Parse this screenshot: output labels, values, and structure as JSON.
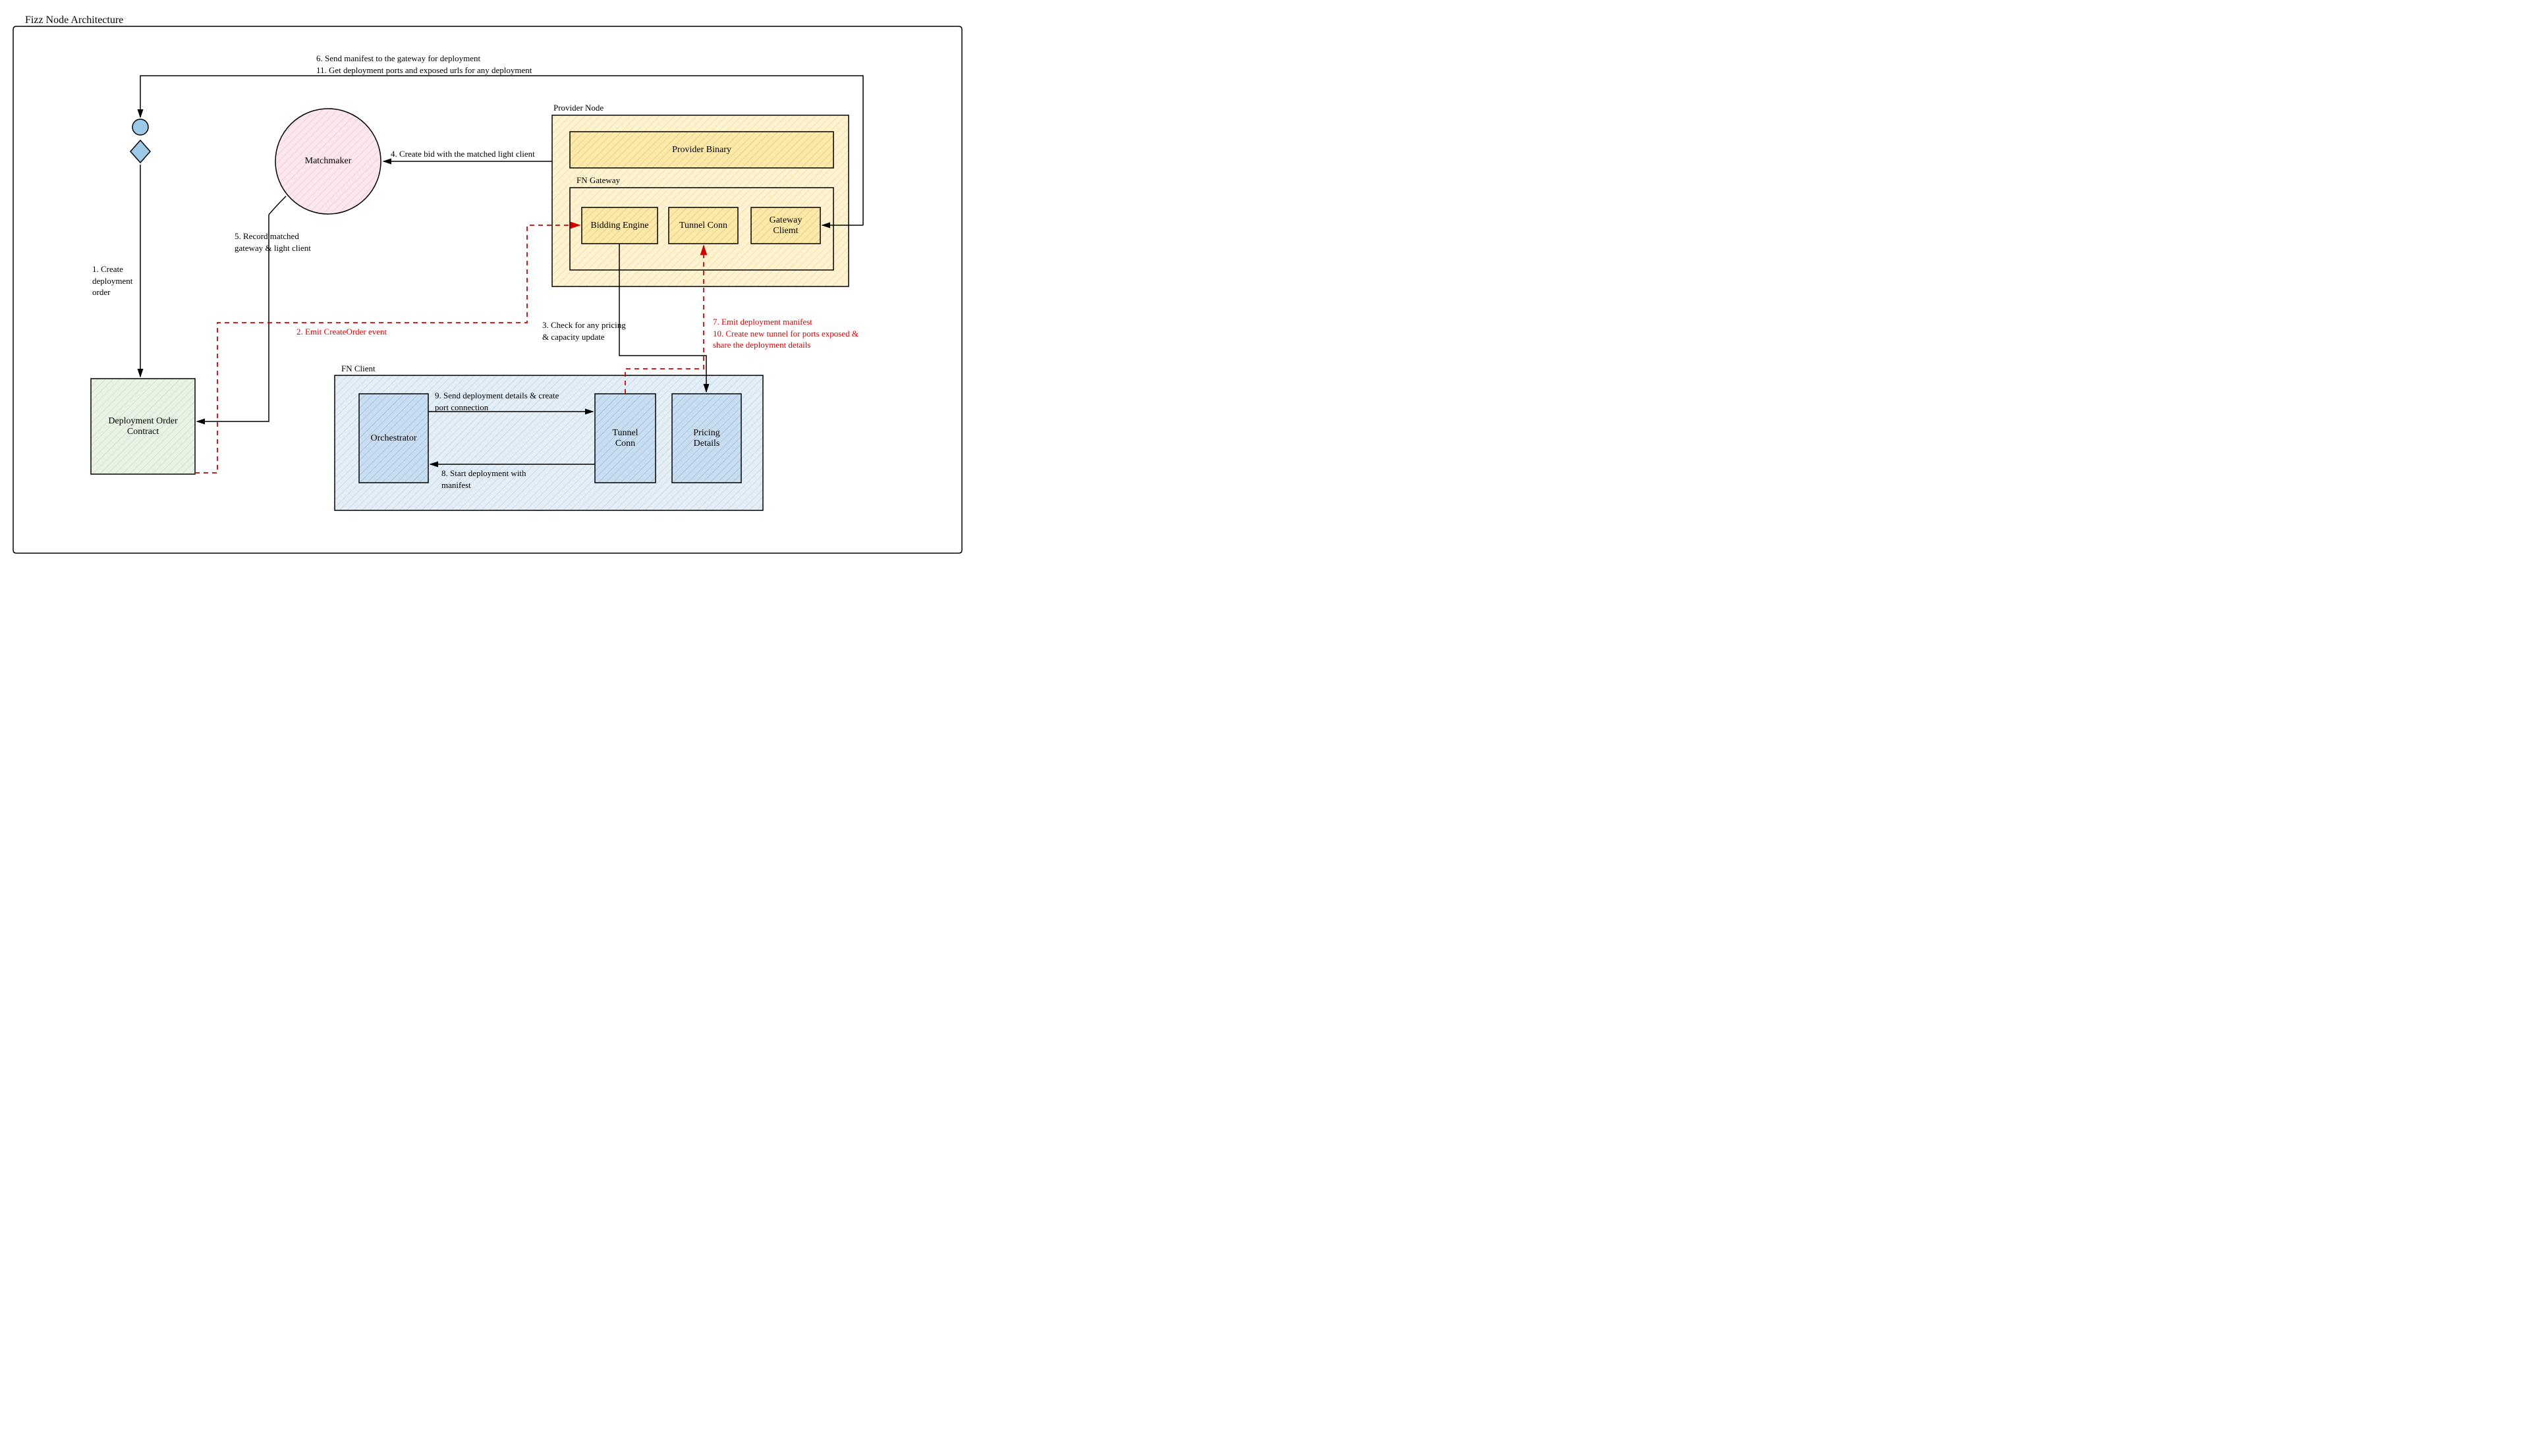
{
  "title": "Fizz Node Architecture",
  "nodes": {
    "matchmaker": "Matchmaker",
    "deployment_order_contract": "Deployment Order\nContract",
    "provider_node_title": "Provider Node",
    "provider_binary": "Provider Binary",
    "fn_gateway_title": "FN Gateway",
    "bidding_engine": "Bidding Engine",
    "tunnel_conn_gw": "Tunnel Conn",
    "gateway_client": "Gateway\nCliemt",
    "fn_client_title": "FN Client",
    "orchestrator": "Orchestrator",
    "tunnel_conn_client": "Tunnel\nConn",
    "pricing_details": "Pricing\nDetails"
  },
  "edges": {
    "e1": "1. Create\ndeployment\norder",
    "e2": "2. Emit CreateOrder event",
    "e3": "3. Check for any pricing\n& capacity update",
    "e4": "4. Create bid with the matched light client",
    "e5": "5. Record matched\ngateway & light client",
    "e6": "6. Send manifest to the gateway for deployment\n11. Get deployment ports and exposed urls for any deployment",
    "e7": "7. Emit deployment manifest\n10. Create new tunnel for ports exposed &\nshare the deployment details",
    "e8": "8. Start deployment with\nmanifest",
    "e9": "9. Send deployment details & create\nport connection"
  },
  "colors": {
    "matchmaker_fill": "#fce8ec",
    "green_fill": "#d9ead8",
    "yellow_fill": "#fde9a9",
    "yellow_deep": "#f7d770",
    "blue_fill": "#d4e5f4",
    "blue_deep": "#9cc4e4",
    "actor_fill": "#7ec0ee",
    "red_stroke": "#d00000"
  }
}
